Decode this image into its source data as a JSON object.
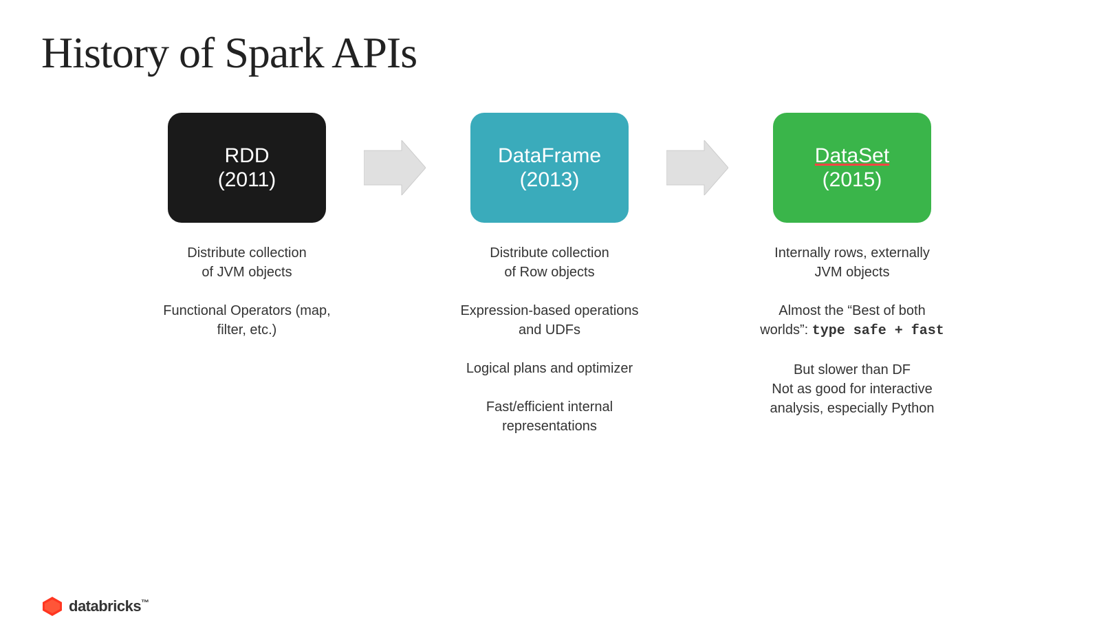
{
  "page": {
    "title": "History of Spark APIs",
    "columns": [
      {
        "id": "rdd",
        "box_line1": "RDD",
        "box_line2": "(2011)",
        "box_color": "rdd",
        "descriptions": [
          "Distribute collection\nof JVM objects",
          "Functional Operators (map,\nfilter, etc.)"
        ]
      },
      {
        "id": "dataframe",
        "box_line1": "DataFrame",
        "box_line2": "(2013)",
        "box_color": "df",
        "descriptions": [
          "Distribute collection\nof Row objects",
          "Expression-based operations\nand UDFs",
          "Logical plans and optimizer",
          "Fast/efficient internal\nrepresentations"
        ]
      },
      {
        "id": "dataset",
        "box_line1": "DataSet",
        "box_line2": "(2015)",
        "box_color": "ds",
        "descriptions": [
          "Internally rows, externally\nJVM objects",
          "Almost the “Best of both\nworlds”: type safe + fast",
          "But slower than DF\nNot as good for interactive\nanalysis, especially Python"
        ]
      }
    ],
    "databricks": {
      "name": "databricks",
      "trademark": "™"
    }
  }
}
